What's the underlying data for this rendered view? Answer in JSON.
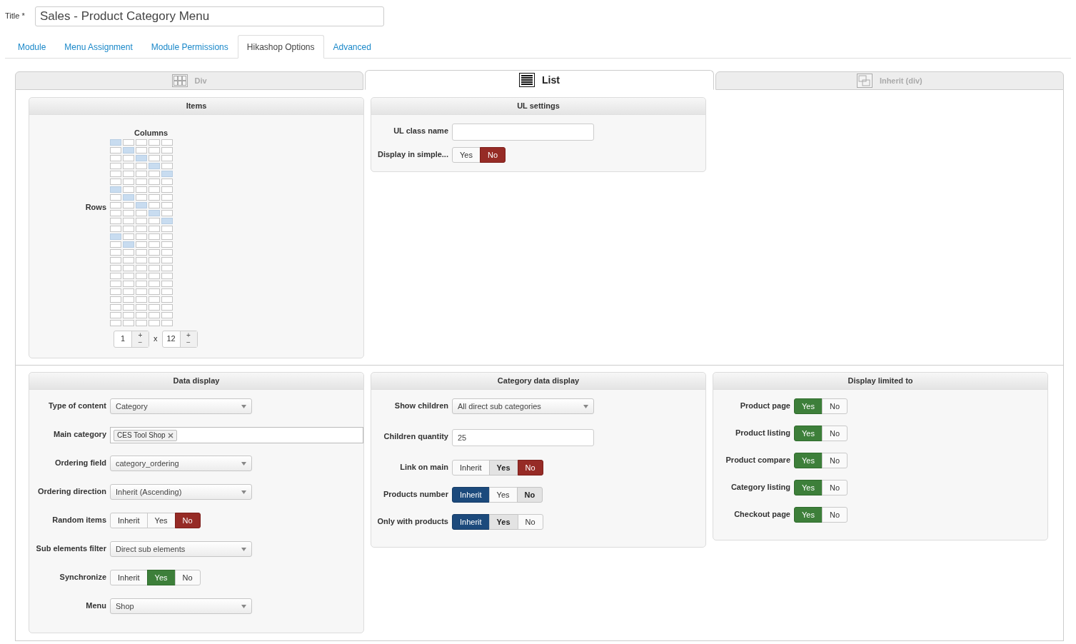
{
  "title_field": {
    "label": "Title *",
    "value": "Sales - Product Category Menu"
  },
  "tabs": [
    {
      "label": "Module",
      "selected": false
    },
    {
      "label": "Menu Assignment",
      "selected": false
    },
    {
      "label": "Module Permissions",
      "selected": false
    },
    {
      "label": "Hikashop Options",
      "selected": true
    },
    {
      "label": "Advanced",
      "selected": false
    }
  ],
  "layout_tabs": [
    {
      "label": "Div",
      "kind": "grid",
      "selected": false
    },
    {
      "label": "List",
      "kind": "list",
      "selected": true
    },
    {
      "label": "Inherit (div)",
      "kind": "inherit",
      "selected": false
    }
  ],
  "items_panel": {
    "title": "Items",
    "columns_label": "Columns",
    "rows_label": "Rows",
    "separator": "x",
    "spinners": [
      {
        "value": "1",
        "increment": "+",
        "decrement": "−"
      },
      {
        "value": "12",
        "increment": "+",
        "decrement": "−"
      }
    ],
    "grid_rows": [
      [
        {
          "selected": true
        },
        {
          "selected": false
        },
        {
          "selected": false
        },
        {
          "selected": false
        },
        {
          "selected": false
        }
      ],
      [
        {
          "selected": false
        },
        {
          "selected": true
        },
        {
          "selected": false
        },
        {
          "selected": false
        },
        {
          "selected": false
        }
      ],
      [
        {
          "selected": false
        },
        {
          "selected": false
        },
        {
          "selected": true
        },
        {
          "selected": false
        },
        {
          "selected": false
        }
      ],
      [
        {
          "selected": false
        },
        {
          "selected": false
        },
        {
          "selected": false
        },
        {
          "selected": true
        },
        {
          "selected": false
        }
      ],
      [
        {
          "selected": false
        },
        {
          "selected": false
        },
        {
          "selected": false
        },
        {
          "selected": false
        },
        {
          "selected": true
        }
      ],
      [
        {
          "selected": false
        },
        {
          "selected": false
        },
        {
          "selected": false
        },
        {
          "selected": false
        },
        {
          "selected": false
        }
      ],
      [
        {
          "selected": true
        },
        {
          "selected": false
        },
        {
          "selected": false
        },
        {
          "selected": false
        },
        {
          "selected": false
        }
      ],
      [
        {
          "selected": false
        },
        {
          "selected": true
        },
        {
          "selected": false
        },
        {
          "selected": false
        },
        {
          "selected": false
        }
      ],
      [
        {
          "selected": false
        },
        {
          "selected": false
        },
        {
          "selected": true
        },
        {
          "selected": false
        },
        {
          "selected": false
        }
      ],
      [
        {
          "selected": false
        },
        {
          "selected": false
        },
        {
          "selected": false
        },
        {
          "selected": true
        },
        {
          "selected": false
        }
      ],
      [
        {
          "selected": false
        },
        {
          "selected": false
        },
        {
          "selected": false
        },
        {
          "selected": false
        },
        {
          "selected": true
        }
      ],
      [
        {
          "selected": false
        },
        {
          "selected": false
        },
        {
          "selected": false
        },
        {
          "selected": false
        },
        {
          "selected": false
        }
      ],
      [
        {
          "selected": true
        },
        {
          "selected": false
        },
        {
          "selected": false
        },
        {
          "selected": false
        },
        {
          "selected": false
        }
      ],
      [
        {
          "selected": false
        },
        {
          "selected": true
        },
        {
          "selected": false
        },
        {
          "selected": false
        },
        {
          "selected": false
        }
      ],
      [
        {
          "selected": false
        },
        {
          "selected": false
        },
        {
          "selected": false
        },
        {
          "selected": false
        },
        {
          "selected": false
        }
      ],
      [
        {
          "selected": false
        },
        {
          "selected": false
        },
        {
          "selected": false
        },
        {
          "selected": false
        },
        {
          "selected": false
        }
      ],
      [
        {
          "selected": false
        },
        {
          "selected": false
        },
        {
          "selected": false
        },
        {
          "selected": false
        },
        {
          "selected": false
        }
      ],
      [
        {
          "selected": false
        },
        {
          "selected": false
        },
        {
          "selected": false
        },
        {
          "selected": false
        },
        {
          "selected": false
        }
      ],
      [
        {
          "selected": false
        },
        {
          "selected": false
        },
        {
          "selected": false
        },
        {
          "selected": false
        },
        {
          "selected": false
        }
      ],
      [
        {
          "selected": false
        },
        {
          "selected": false
        },
        {
          "selected": false
        },
        {
          "selected": false
        },
        {
          "selected": false
        }
      ],
      [
        {
          "selected": false
        },
        {
          "selected": false
        },
        {
          "selected": false
        },
        {
          "selected": false
        },
        {
          "selected": false
        }
      ],
      [
        {
          "selected": false
        },
        {
          "selected": false
        },
        {
          "selected": false
        },
        {
          "selected": false
        },
        {
          "selected": false
        }
      ],
      [
        {
          "selected": false
        },
        {
          "selected": false
        },
        {
          "selected": false
        },
        {
          "selected": false
        },
        {
          "selected": false
        }
      ],
      [
        {
          "selected": false
        },
        {
          "selected": false
        },
        {
          "selected": false
        },
        {
          "selected": false
        },
        {
          "selected": false
        }
      ]
    ]
  },
  "ul_settings": {
    "title": "UL settings",
    "fields": [
      {
        "kind": "text",
        "label": "UL class name"
      },
      {
        "kind": "toggle",
        "label": "Display in simple...",
        "options": [
          {
            "label": "Yes",
            "kind": "yes",
            "selected": false,
            "default": false
          },
          {
            "label": "No",
            "kind": "no",
            "selected": true,
            "default": false
          }
        ]
      }
    ]
  },
  "bottom_panels": [
    {
      "title": "Data display",
      "fields": [
        {
          "kind": "select",
          "label": "Type of content",
          "value": "Category"
        },
        {
          "kind": "tags",
          "label": "Main category",
          "tags": [
            "CES Tool Shop"
          ]
        },
        {
          "kind": "select",
          "label": "Ordering field",
          "value": "category_ordering"
        },
        {
          "kind": "select",
          "label": "Ordering direction",
          "value": "Inherit (Ascending)"
        },
        {
          "kind": "toggle",
          "label": "Random items",
          "options": [
            {
              "label": "Inherit",
              "kind": "inherit",
              "selected": false,
              "default": false
            },
            {
              "label": "Yes",
              "kind": "yes",
              "selected": false,
              "default": false
            },
            {
              "label": "No",
              "kind": "no",
              "selected": true,
              "default": false
            }
          ]
        },
        {
          "kind": "select",
          "label": "Sub elements filter",
          "value": "Direct sub elements"
        },
        {
          "kind": "toggle",
          "label": "Synchronize",
          "options": [
            {
              "label": "Inherit",
              "kind": "inherit",
              "selected": false,
              "default": false
            },
            {
              "label": "Yes",
              "kind": "yes",
              "selected": true,
              "default": false
            },
            {
              "label": "No",
              "kind": "no",
              "selected": false,
              "default": false
            }
          ]
        },
        {
          "kind": "select",
          "label": "Menu",
          "value": "Shop"
        }
      ]
    },
    {
      "title": "Category data display",
      "fields": [
        {
          "kind": "select",
          "label": "Show children",
          "value": "All direct sub categories"
        },
        {
          "kind": "text",
          "label": "Children quantity",
          "value": "25"
        },
        {
          "kind": "toggle",
          "label": "Link on main",
          "options": [
            {
              "label": "Inherit",
              "kind": "inherit",
              "selected": false,
              "default": false
            },
            {
              "label": "Yes",
              "kind": "yes",
              "selected": false,
              "default": true
            },
            {
              "label": "No",
              "kind": "no",
              "selected": true,
              "default": false
            }
          ]
        },
        {
          "kind": "toggle",
          "label": "Products number",
          "options": [
            {
              "label": "Inherit",
              "kind": "inherit",
              "selected": true,
              "default": false
            },
            {
              "label": "Yes",
              "kind": "yes",
              "selected": false,
              "default": false
            },
            {
              "label": "No",
              "kind": "no",
              "selected": false,
              "default": true
            }
          ]
        },
        {
          "kind": "toggle",
          "label": "Only with products",
          "options": [
            {
              "label": "Inherit",
              "kind": "inherit",
              "selected": true,
              "default": false
            },
            {
              "label": "Yes",
              "kind": "yes",
              "selected": false,
              "default": true
            },
            {
              "label": "No",
              "kind": "no",
              "selected": false,
              "default": false
            }
          ]
        }
      ]
    },
    {
      "title": "Display limited to",
      "fields": [
        {
          "kind": "toggle",
          "label": "Product page",
          "options": [
            {
              "label": "Yes",
              "kind": "yes",
              "selected": true,
              "default": false
            },
            {
              "label": "No",
              "kind": "no",
              "selected": false,
              "default": false
            }
          ]
        },
        {
          "kind": "toggle",
          "label": "Product listing",
          "options": [
            {
              "label": "Yes",
              "kind": "yes",
              "selected": true,
              "default": false
            },
            {
              "label": "No",
              "kind": "no",
              "selected": false,
              "default": false
            }
          ]
        },
        {
          "kind": "toggle",
          "label": "Product compare",
          "options": [
            {
              "label": "Yes",
              "kind": "yes",
              "selected": true,
              "default": false
            },
            {
              "label": "No",
              "kind": "no",
              "selected": false,
              "default": false
            }
          ]
        },
        {
          "kind": "toggle",
          "label": "Category listing",
          "options": [
            {
              "label": "Yes",
              "kind": "yes",
              "selected": true,
              "default": false
            },
            {
              "label": "No",
              "kind": "no",
              "selected": false,
              "default": false
            }
          ]
        },
        {
          "kind": "toggle",
          "label": "Checkout page",
          "options": [
            {
              "label": "Yes",
              "kind": "yes",
              "selected": true,
              "default": false
            },
            {
              "label": "No",
              "kind": "no",
              "selected": false,
              "default": false
            }
          ]
        }
      ]
    }
  ]
}
